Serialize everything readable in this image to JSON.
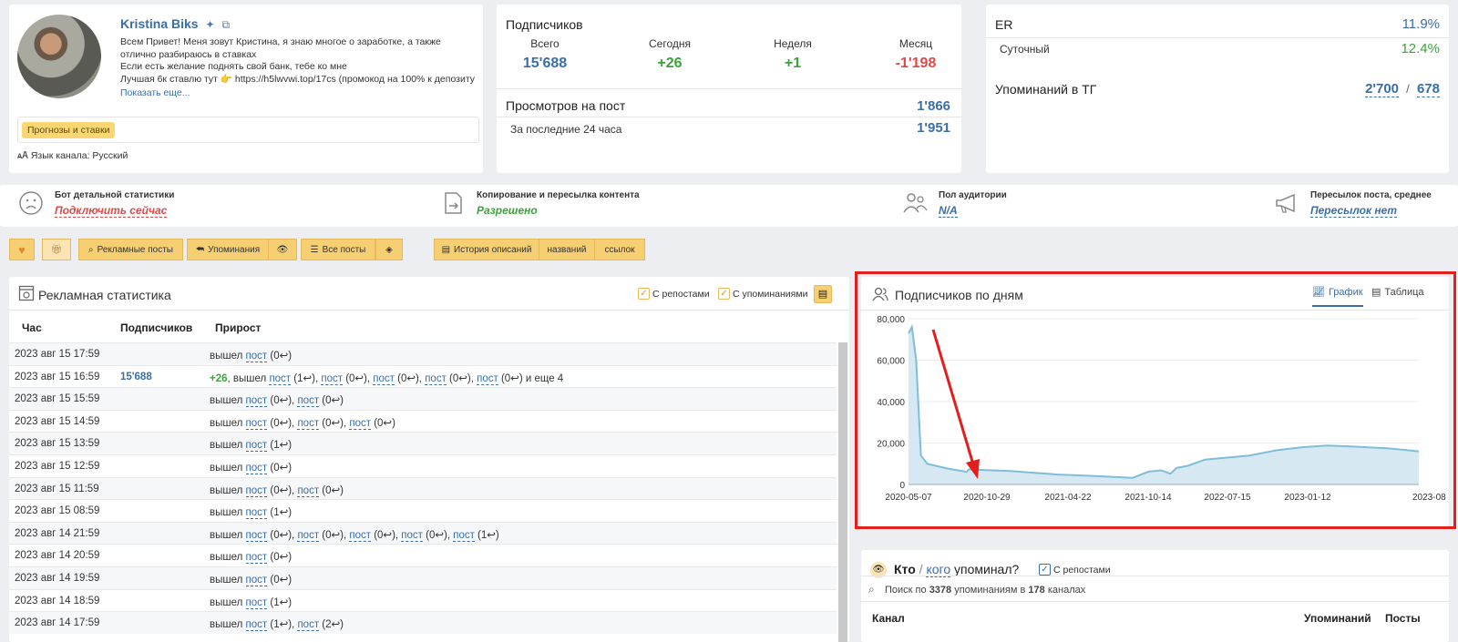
{
  "profile": {
    "name": "Kristina Biks",
    "description_lines": [
      "Всем Привет! Меня зовут Кристина, я знаю многое о заработке, а также",
      "отлично разбираюсь в ставках",
      "Если есть желание поднять свой банк, тебе ко мне",
      "Лучшая 6к ставлю тут 👉 https://h5lwvwi.top/17cs (промокод на 100% к депозиту"
    ],
    "show_more": "Показать еще...",
    "tag": "Прогнозы и ставки",
    "language": "Язык канала: Русский"
  },
  "subscribers": {
    "title": "Подписчиков",
    "cols": [
      {
        "label": "Всего",
        "value": "15'688",
        "color": "#3a6ea8"
      },
      {
        "label": "Сегодня",
        "value": "+26",
        "color": "#3aa33a"
      },
      {
        "label": "Неделя",
        "value": "+1",
        "color": "#3aa33a"
      },
      {
        "label": "Месяц",
        "value": "-1'198",
        "color": "#e04848"
      }
    ],
    "views_title": "Просмотров на пост",
    "views_value": "1'866",
    "last24_label": "За последние 24 часа",
    "last24_value": "1'951"
  },
  "er": {
    "title": "ER",
    "value": "11.9%",
    "daily_label": "Суточный",
    "daily_value": "12.4%",
    "mentions_title": "Упоминаний в ТГ",
    "mentions_a": "2'700",
    "mentions_sep": "/",
    "mentions_b": "678"
  },
  "strip": [
    {
      "title": "Бот детальной статистики",
      "value": "Подключить сейчас",
      "color": "#e04848",
      "icon": "sad-face-icon"
    },
    {
      "title": "Копирование и пересылка контента",
      "value": "Разрешено",
      "color": "#3aa33a",
      "icon": "forward-doc-icon"
    },
    {
      "title": "Пол аудитории",
      "value": "N/A",
      "color": "#3a6ea8",
      "icon": "audience-icon"
    },
    {
      "title": "Пересылок поста, среднее",
      "value": "Пересылок нет",
      "color": "#3a6ea8",
      "icon": "megaphone-icon"
    }
  ],
  "toolbar": {
    "ads_posts": "Рекламные посты",
    "mentions": "Упоминания",
    "all_posts": "Все посты",
    "history": "История описаний",
    "names": "названий",
    "links": "ссылок"
  },
  "ads": {
    "title": "Рекламная статистика",
    "chk_reposts": "С репостами",
    "chk_mentions": "С упоминаниями",
    "headers": {
      "hour": "Час",
      "subs": "Подписчиков",
      "growth": "Прирост"
    },
    "rows": [
      {
        "time": "2023 авг 15 17:59",
        "subs": "",
        "growth": "вышел пост (0↩)"
      },
      {
        "time": "2023 авг 15 16:59",
        "subs": "15'688",
        "growth": "+26, вышел пост (1↩), пост (0↩), пост (0↩), пост (0↩), пост (0↩) и еще 4"
      },
      {
        "time": "2023 авг 15 15:59",
        "subs": "",
        "growth": "вышел пост (0↩), пост (0↩)"
      },
      {
        "time": "2023 авг 15 14:59",
        "subs": "",
        "growth": "вышел пост (0↩), пост (0↩), пост (0↩)"
      },
      {
        "time": "2023 авг 15 13:59",
        "subs": "",
        "growth": "вышел пост (1↩)"
      },
      {
        "time": "2023 авг 15 12:59",
        "subs": "",
        "growth": "вышел пост (0↩)"
      },
      {
        "time": "2023 авг 15 11:59",
        "subs": "",
        "growth": "вышел пост (0↩), пост (0↩)"
      },
      {
        "time": "2023 авг 15 08:59",
        "subs": "",
        "growth": "вышел пост (1↩)"
      },
      {
        "time": "2023 авг 14 21:59",
        "subs": "",
        "growth": "вышел пост (0↩), пост (0↩), пост (0↩), пост (0↩), пост (1↩)"
      },
      {
        "time": "2023 авг 14 20:59",
        "subs": "",
        "growth": "вышел пост (0↩)"
      },
      {
        "time": "2023 авг 14 19:59",
        "subs": "",
        "growth": "вышел пост (0↩)"
      },
      {
        "time": "2023 авг 14 18:59",
        "subs": "",
        "growth": "вышел пост (1↩)"
      },
      {
        "time": "2023 авг 14 17:59",
        "subs": "",
        "growth": "вышел пост (1↩), пост (2↩)"
      }
    ]
  },
  "chart_panel": {
    "title": "Подписчиков по дням",
    "tab_graph": "График",
    "tab_table": "Таблица"
  },
  "chart_data": {
    "type": "area",
    "title": "",
    "x_ticks": [
      "2020-05-07",
      "2020-10-29",
      "2021-04-22",
      "2021-10-14",
      "2022-07-15",
      "2023-01-12",
      "2023-08"
    ],
    "y_ticks": [
      0,
      20000,
      40000,
      60000,
      80000
    ],
    "y_tick_labels": [
      "0",
      "20,000",
      "40,000",
      "60,000",
      "80,000"
    ],
    "ylim": [
      0,
      80000
    ],
    "series": [
      {
        "x": [
          "2020-05-07",
          "2020-05-15",
          "2020-05-25",
          "2020-06-05",
          "2020-06-20",
          "2020-07-10",
          "2020-08-10",
          "2020-09-10",
          "2020-09-20",
          "2020-09-25",
          "2020-10-29",
          "2021-01-01",
          "2021-04-22",
          "2021-07-01",
          "2021-10-14",
          "2021-11-20",
          "2021-12-20",
          "2022-01-10",
          "2022-01-25",
          "2022-02-20",
          "2022-04-01",
          "2022-07-15",
          "2022-09-15",
          "2022-11-15",
          "2023-01-12",
          "2023-03-15",
          "2023-06-01",
          "2023-08-15"
        ],
        "y": [
          73000,
          76000,
          60000,
          14000,
          10000,
          9000,
          7500,
          6500,
          6000,
          7300,
          7000,
          6500,
          4800,
          4200,
          3200,
          6200,
          6800,
          5200,
          8000,
          9000,
          12000,
          14000,
          16500,
          18000,
          18800,
          18300,
          17500,
          16000
        ]
      }
    ],
    "x_range": [
      "2020-05-07",
      "2023-08-15"
    ]
  },
  "mentions": {
    "who": "Кто",
    "sep": "/",
    "whom": "кого",
    "rest": "упоминал?",
    "chk_reposts": "С репостами",
    "search_prefix": "Поиск по",
    "search_count": "3378",
    "search_mid": "упоминаниям в",
    "search_channels": "178",
    "search_suffix": "каналах",
    "col_channel": "Канал",
    "col_mentions": "Упоминаний",
    "col_posts": "Посты"
  }
}
